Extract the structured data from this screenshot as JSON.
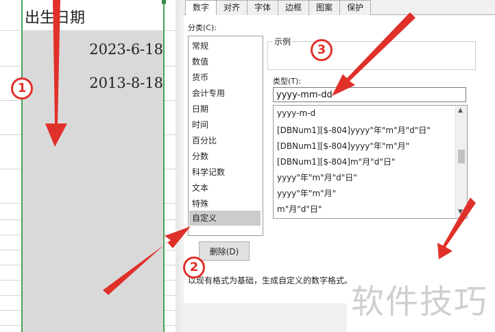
{
  "spreadsheet": {
    "column_header": "出生日期",
    "dates": [
      "2023-6-18",
      "2013-8-18"
    ]
  },
  "dialog": {
    "tabs": [
      "数字",
      "对齐",
      "字体",
      "边框",
      "图案",
      "保护"
    ],
    "active_tab": "数字",
    "category_label": "分类(C):",
    "categories": [
      "常规",
      "数值",
      "货币",
      "会计专用",
      "日期",
      "时间",
      "百分比",
      "分数",
      "科学记数",
      "文本",
      "特殊",
      "自定义"
    ],
    "selected_category": "自定义",
    "sample_label": "示例",
    "type_label": "类型(T):",
    "type_value": "yyyy-mm-dd",
    "format_list": [
      "yyyy-m-d",
      "[DBNum1][$-804]yyyy\"年\"m\"月\"d\"日\"",
      "[DBNum1][$-804]yyyy\"年\"m\"月\"",
      "[DBNum1][$-804]m\"月\"d\"日\"",
      "yyyy\"年\"m\"月\"d\"日\"",
      "yyyy\"年\"m\"月\"",
      "m\"月\"d\"日\""
    ],
    "delete_button": "删除(D)",
    "hint": "以现有格式为基础，生成自定义的数字格式。"
  },
  "annotations": {
    "badges": [
      "1",
      "2",
      "3"
    ],
    "color": "#e0302a"
  },
  "watermark": "软件技巧"
}
